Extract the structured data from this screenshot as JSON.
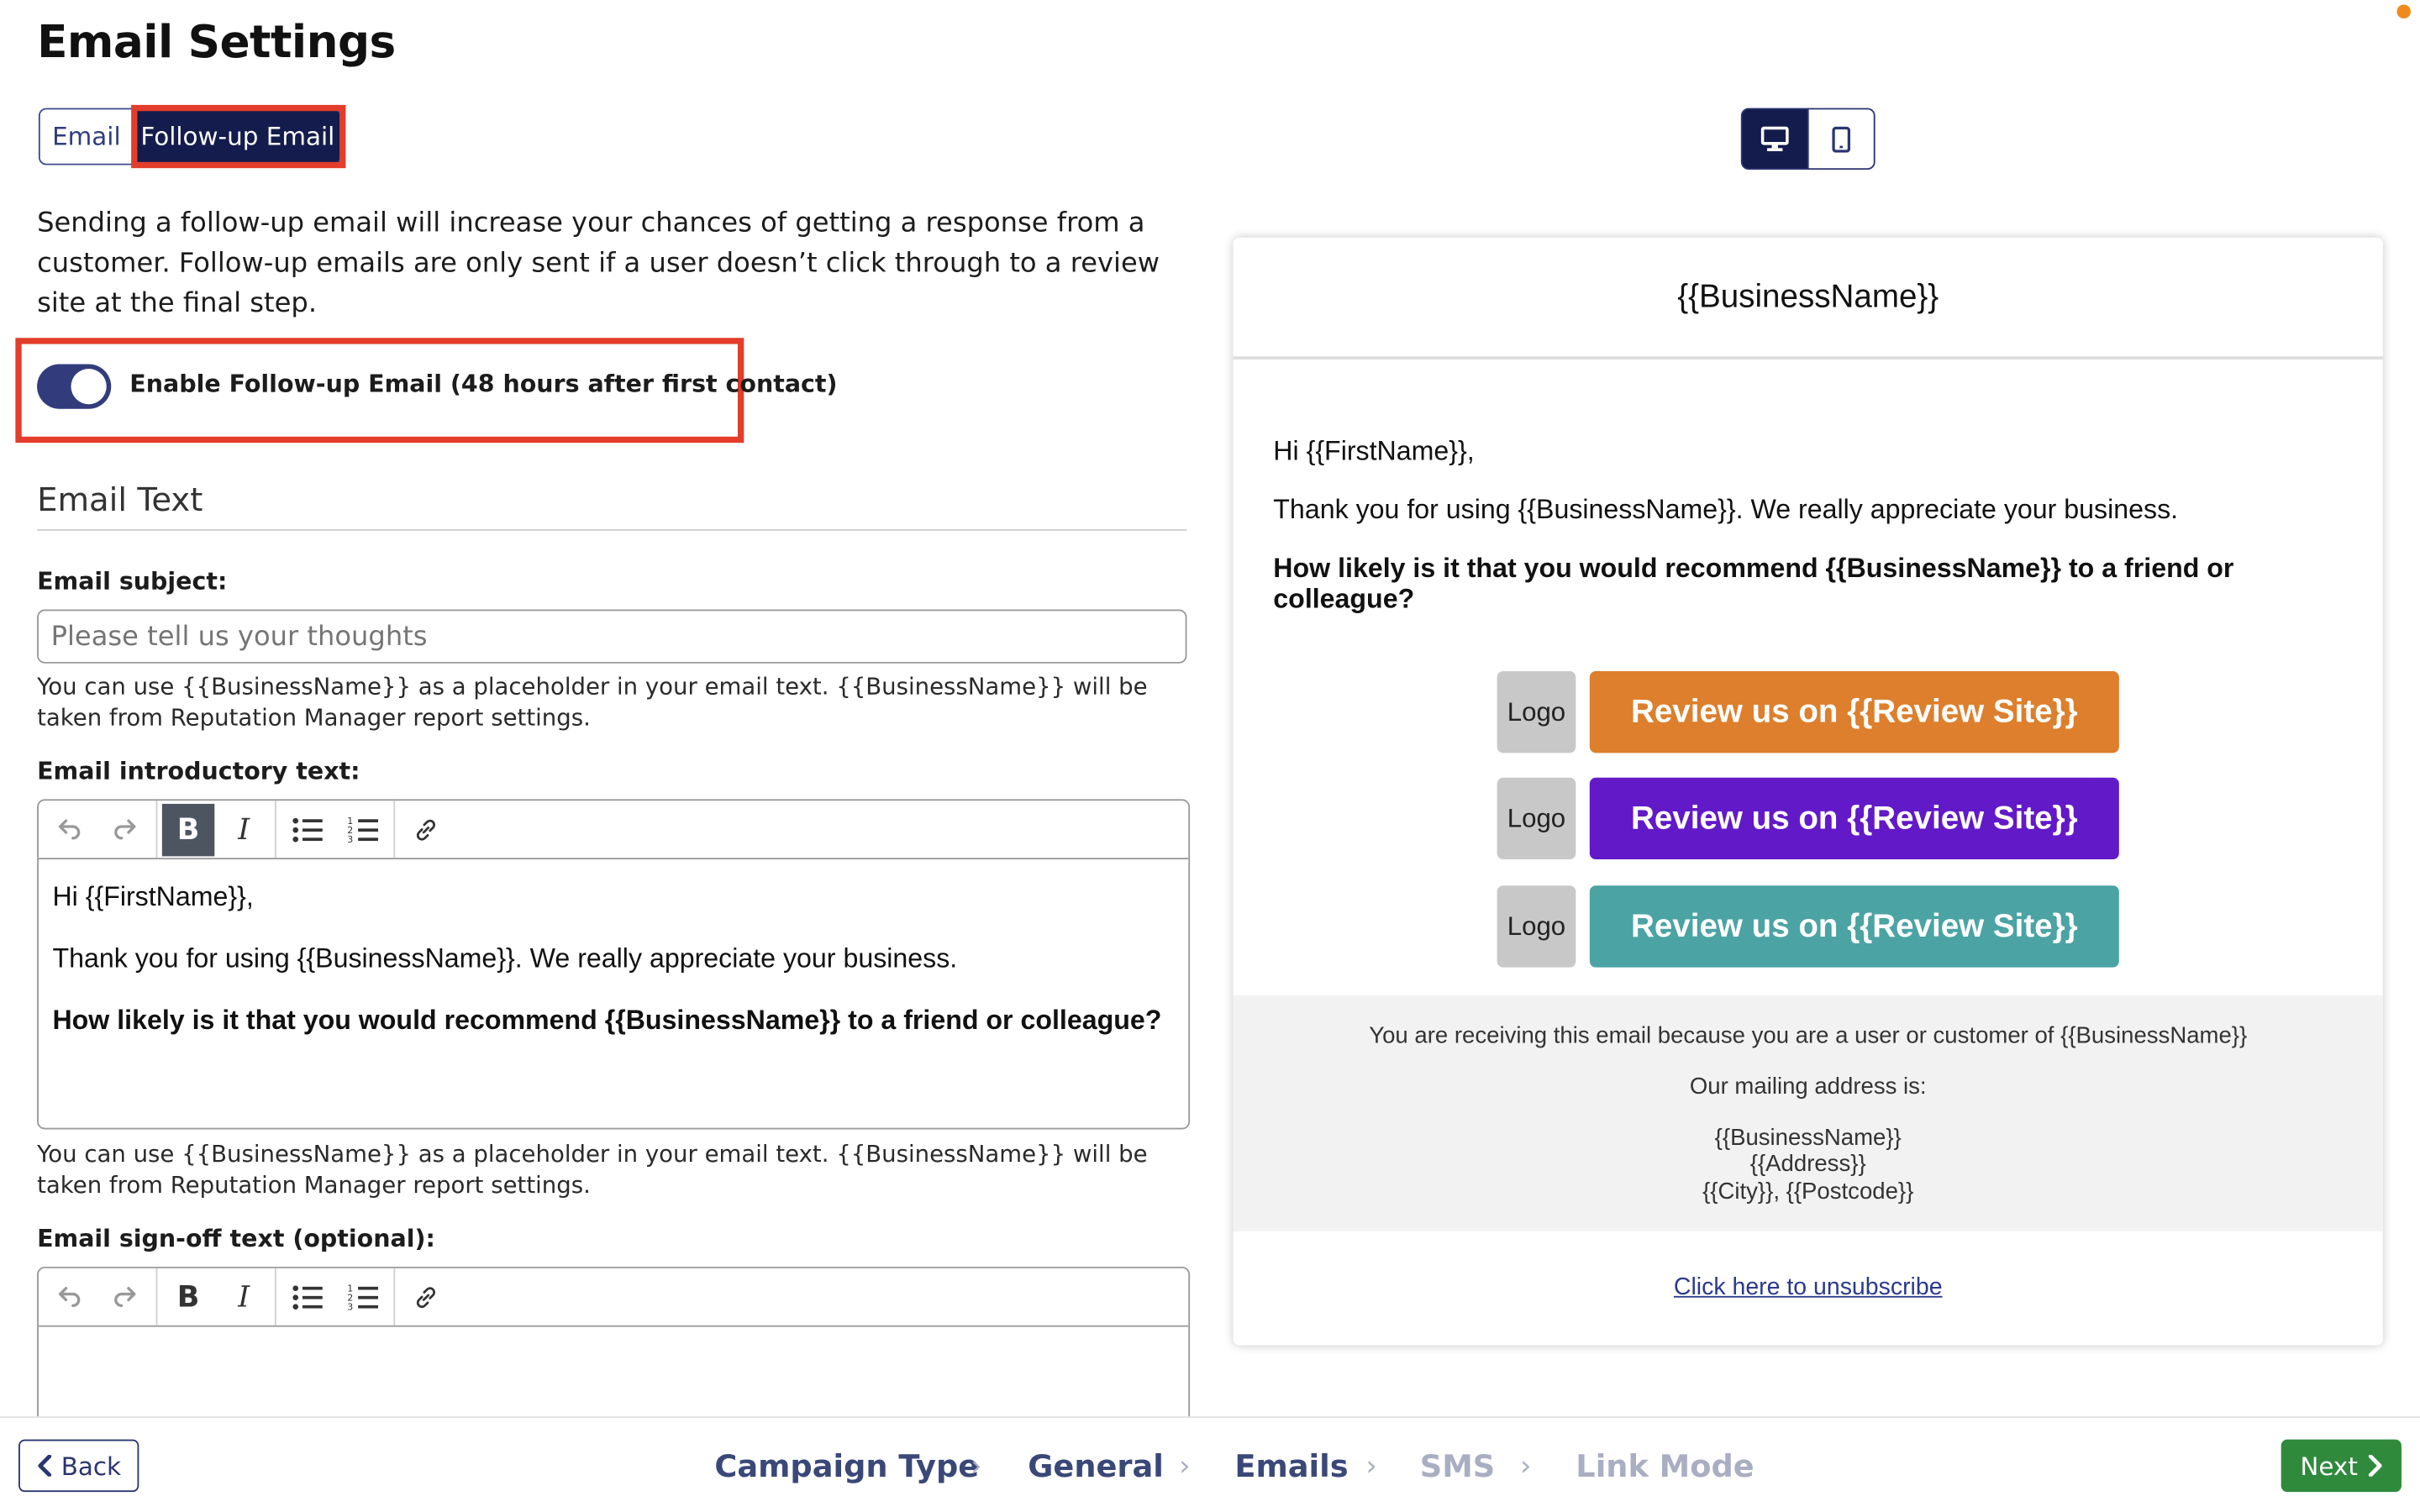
{
  "page": {
    "title": "Email Settings"
  },
  "tabs": [
    {
      "label": "Email",
      "active": false
    },
    {
      "label": "Follow-up Email",
      "active": true
    }
  ],
  "description": "Sending a follow-up email will increase your chances of getting a response from a customer. Follow-up emails are only sent if a user doesn’t click through to a review site at the final step.",
  "followup_toggle": {
    "label": "Enable Follow-up Email (48 hours after first contact)",
    "enabled": true
  },
  "email_text": {
    "section_title": "Email Text",
    "subject_label": "Email subject:",
    "subject_placeholder": "Please tell us your thoughts",
    "subject_value": "",
    "placeholder_help": "You can use {{BusinessName}} as a placeholder in your email text. {{BusinessName}} will be taken from Reputation Manager report settings.",
    "intro_label": "Email introductory text:",
    "intro_lines": [
      "Hi {{FirstName}},",
      "Thank you for using {{BusinessName}}. We really appreciate your business.",
      "How likely is it that you would recommend {{BusinessName}} to a friend or colleague?"
    ],
    "signoff_label": "Email sign-off text (optional):"
  },
  "editor_toolbar": {
    "tools": [
      "undo-icon",
      "redo-icon",
      "bold-icon",
      "italic-icon",
      "bullet-list-icon",
      "numbered-list-icon",
      "link-icon"
    ],
    "bold_glyph": "B",
    "italic_glyph": "I"
  },
  "preview": {
    "device_options": [
      "desktop",
      "mobile"
    ],
    "selected_device": "desktop",
    "header": "{{BusinessName}}",
    "greeting": "Hi {{FirstName}},",
    "thanks": "Thank you for using {{BusinessName}}. We really appreciate your business.",
    "question": "How likely is it that you would recommend {{BusinessName}} to a friend or colleague?",
    "review_buttons": [
      {
        "logo": "Logo",
        "label": "Review us on {{Review Site}}",
        "color": "#dd7f2c"
      },
      {
        "logo": "Logo",
        "label": "Review us on {{Review Site}}",
        "color": "#6219c8"
      },
      {
        "logo": "Logo",
        "label": "Review us on {{Review Site}}",
        "color": "#4ba3a4"
      }
    ],
    "footer": {
      "reason": "You are receiving this email because you are a user or customer of {{BusinessName}}",
      "address_label": "Our mailing address is:",
      "address_lines": [
        "{{BusinessName}}",
        "{{Address}}",
        "{{City}}, {{Postcode}}"
      ]
    },
    "unsubscribe": "Click here to unsubscribe"
  },
  "bottom_nav": {
    "back_label": "Back",
    "next_label": "Next",
    "steps": [
      {
        "label": "Campaign Type",
        "state": "done"
      },
      {
        "label": "General",
        "state": "done"
      },
      {
        "label": "Emails",
        "state": "current"
      },
      {
        "label": "SMS",
        "state": "todo"
      },
      {
        "label": "Link Mode",
        "state": "todo"
      }
    ]
  },
  "colors": {
    "primary": "#141c4d",
    "highlight": "#e33d2b",
    "next_button": "#2f8a3c",
    "notification": "#f08a1c"
  }
}
